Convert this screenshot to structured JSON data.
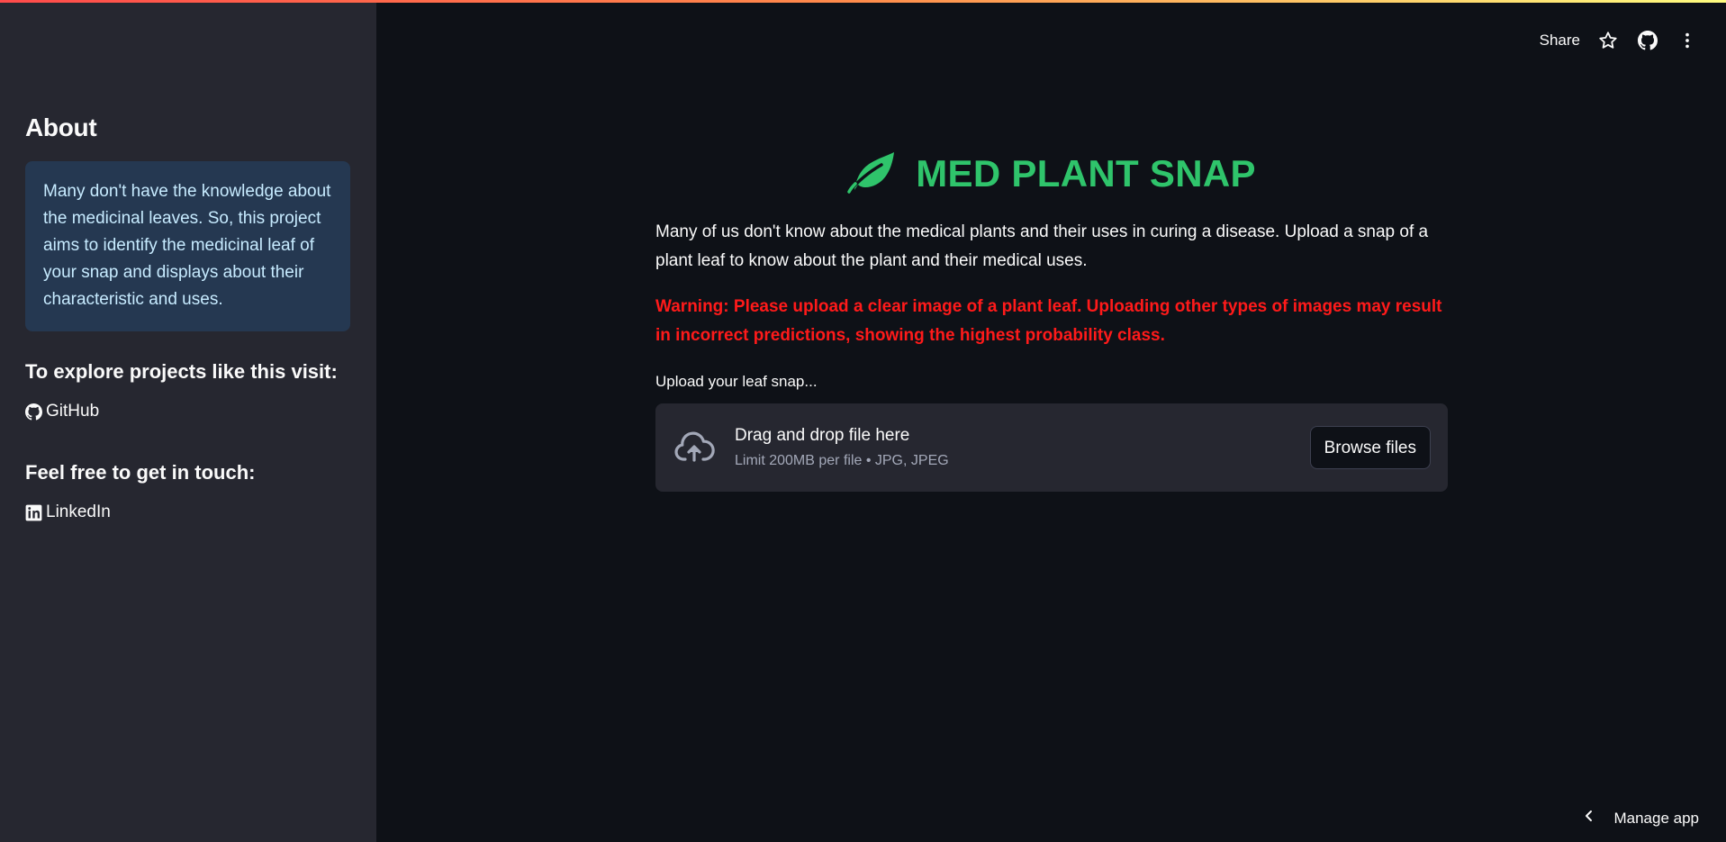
{
  "sidebar": {
    "about_heading": "About",
    "about_text": "Many don't have the knowledge about the medicinal leaves. So, this project aims to identify the medicinal leaf of your snap and displays about their characteristic and uses.",
    "explore_heading": "To explore projects like this visit:",
    "github_label": "GitHub",
    "contact_heading": "Feel free to get in touch:",
    "linkedin_label": "LinkedIn"
  },
  "header": {
    "share_label": "Share",
    "icons": [
      "star-icon",
      "github-icon",
      "more-vertical-icon"
    ]
  },
  "main": {
    "title": "MED PLANT SNAP",
    "title_icon": "leaf-icon",
    "description": "Many of us don't know about the medical plants and their uses in curing a disease. Upload a snap of a plant leaf to know about the plant and their medical uses.",
    "warning": "Warning: Please upload a clear image of a plant leaf. Uploading other types of images may result in incorrect predictions, showing the highest probability class.",
    "uploader": {
      "label": "Upload your leaf snap...",
      "drop_title": "Drag and drop file here",
      "drop_limit": "Limit 200MB per file • JPG, JPEG",
      "browse_label": "Browse files"
    }
  },
  "footer": {
    "manage_app_label": "Manage app"
  },
  "colors": {
    "background": "#0e1117",
    "sidebar": "#262730",
    "title_green": "#2fc46b",
    "warning_red": "#ff1a1a",
    "info_bg": "#253851",
    "info_text": "#c7ebff"
  }
}
